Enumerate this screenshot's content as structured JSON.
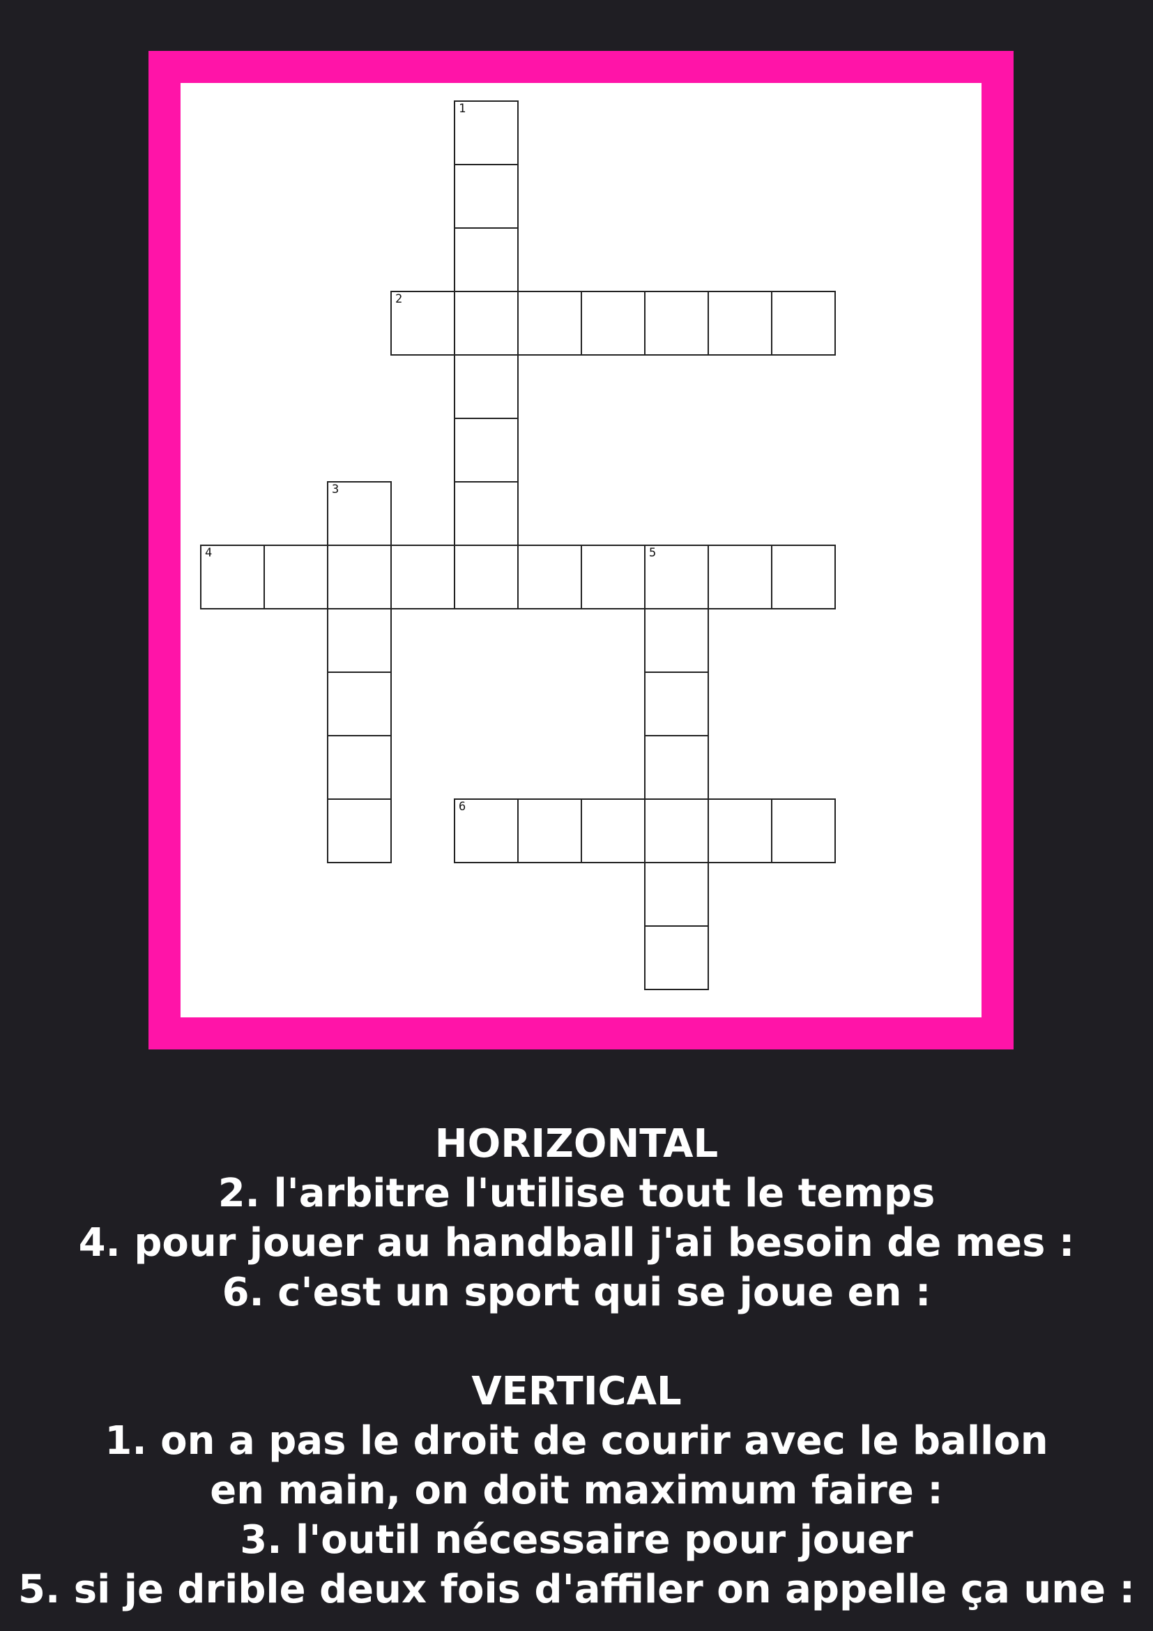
{
  "crossword": {
    "frame_color": "#ff14a8",
    "numbered_cells": [
      {
        "row": 0,
        "col": 4,
        "number": "1"
      },
      {
        "row": 3,
        "col": 3,
        "number": "2"
      },
      {
        "row": 6,
        "col": 2,
        "number": "3"
      },
      {
        "row": 7,
        "col": 0,
        "number": "4"
      },
      {
        "row": 7,
        "col": 7,
        "number": "5"
      },
      {
        "row": 11,
        "col": 4,
        "number": "6"
      }
    ],
    "cells": [
      [
        0,
        4
      ],
      [
        1,
        4
      ],
      [
        2,
        4
      ],
      [
        3,
        3
      ],
      [
        3,
        4
      ],
      [
        3,
        5
      ],
      [
        3,
        6
      ],
      [
        3,
        7
      ],
      [
        3,
        8
      ],
      [
        3,
        9
      ],
      [
        4,
        4
      ],
      [
        5,
        4
      ],
      [
        6,
        4
      ],
      [
        6,
        2
      ],
      [
        7,
        0
      ],
      [
        7,
        1
      ],
      [
        7,
        2
      ],
      [
        7,
        3
      ],
      [
        7,
        4
      ],
      [
        7,
        5
      ],
      [
        7,
        6
      ],
      [
        7,
        7
      ],
      [
        7,
        8
      ],
      [
        7,
        9
      ],
      [
        8,
        2
      ],
      [
        9,
        2
      ],
      [
        10,
        2
      ],
      [
        11,
        2
      ],
      [
        8,
        7
      ],
      [
        9,
        7
      ],
      [
        10,
        7
      ],
      [
        11,
        4
      ],
      [
        11,
        5
      ],
      [
        11,
        6
      ],
      [
        11,
        7
      ],
      [
        11,
        8
      ],
      [
        11,
        9
      ],
      [
        12,
        7
      ],
      [
        13,
        7
      ]
    ]
  },
  "clues": {
    "horizontal_title": "HORIZONTAL",
    "horizontal": [
      "2. l'arbitre l'utilise tout le temps",
      "4. pour jouer au handball j'ai besoin de mes :",
      "6. c'est un sport qui se joue en :"
    ],
    "vertical_title": "VERTICAL",
    "vertical": [
      "1. on a pas le droit de courir avec le ballon",
      "en main, on doit maximum faire :",
      "3. l'outil nécessaire pour jouer",
      "5. si je drible deux fois d'affiler on appelle ça une :"
    ]
  }
}
